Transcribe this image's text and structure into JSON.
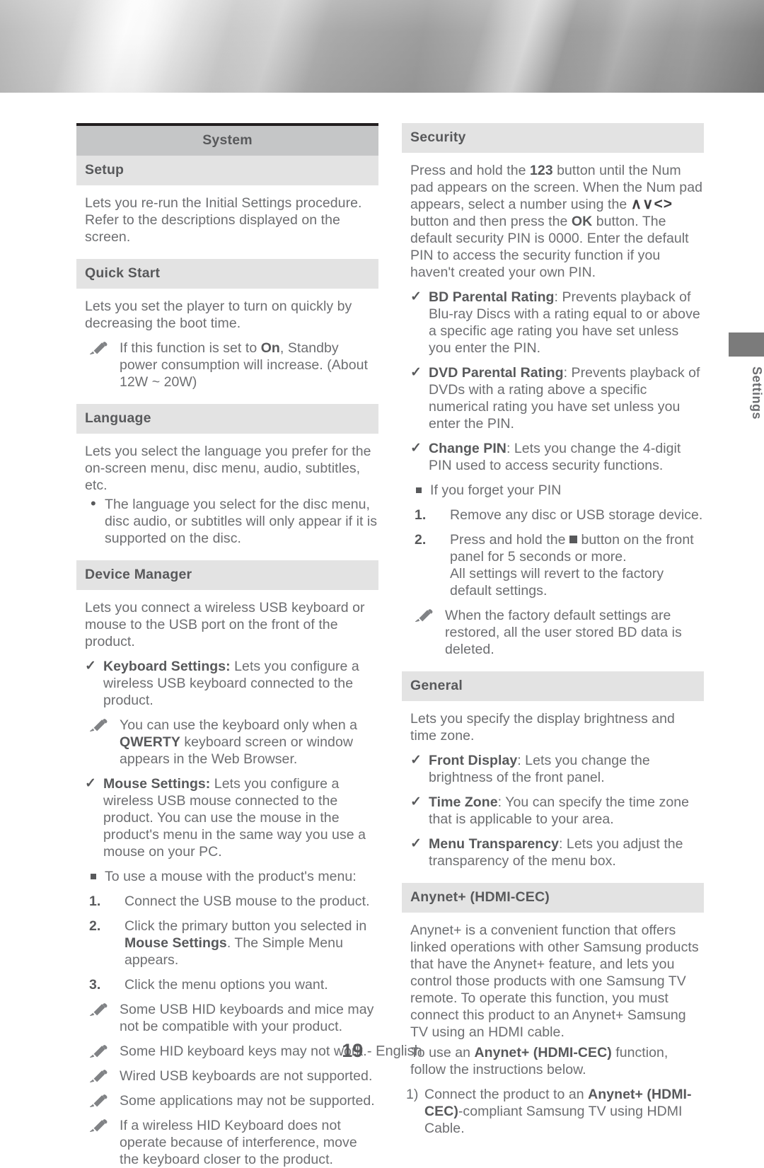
{
  "side_tab": {
    "label": "Settings"
  },
  "footer": {
    "page_number": "19",
    "separator": " - ",
    "language": "English"
  },
  "left_column": {
    "title": "System",
    "setup": {
      "heading": "Setup",
      "body": "Lets you re-run the Initial Settings procedure. Refer to the descriptions displayed on the screen."
    },
    "quick_start": {
      "heading": "Quick Start",
      "body": "Lets you set the player to turn on quickly by decreasing the boot time.",
      "note_prefix": "If this function is set to ",
      "note_bold": "On",
      "note_suffix": ", Standby power consumption will increase. (About 12W ~ 20W)"
    },
    "language": {
      "heading": "Language",
      "body": "Lets you select the language you prefer for the on-screen menu, disc menu, audio, subtitles, etc.",
      "bullet": "The language you select for the disc menu, disc audio, or subtitles will only appear if it is supported on the disc."
    },
    "device_manager": {
      "heading": "Device Manager",
      "body": "Lets you connect a wireless USB keyboard or mouse to the USB port on the front of the product.",
      "keyboard_settings_label": "Keyboard Settings:",
      "keyboard_settings_text": " Lets you configure a wireless USB keyboard connected to the product.",
      "keyboard_note_part1": "You can use the keyboard only when a ",
      "keyboard_note_bold": "QWERTY",
      "keyboard_note_part2": " keyboard screen or window appears in the Web Browser.",
      "mouse_settings_label": "Mouse Settings:",
      "mouse_settings_text": " Lets you configure a wireless USB mouse connected to the product. You can use the mouse in the product's menu in the same way you use a mouse on your PC.",
      "mouse_intro": "To use a mouse with the product's menu:",
      "steps": [
        {
          "num": "1.",
          "text": "Connect the USB mouse to the product."
        },
        {
          "num": "2.",
          "part1": "Click the primary button you selected in ",
          "bold": "Mouse Settings",
          "part2": ". The Simple Menu appears."
        },
        {
          "num": "3.",
          "text": "Click the menu options you want."
        }
      ],
      "notes": [
        "Some USB HID keyboards and mice may not be compatible with your product.",
        "Some HID keyboard keys may not work.",
        "Wired USB keyboards are not supported.",
        "Some applications may not be supported.",
        "If a wireless HID Keyboard does not operate because of interference, move the keyboard closer to the product."
      ]
    }
  },
  "right_column": {
    "security": {
      "heading": "Security",
      "body_p1": "Press and hold the ",
      "body_b1": "123",
      "body_p2": " button until the Num pad appears on the screen. When the Num pad appears, select a number using the ",
      "arrows_glyph": "∧∨<>",
      "body_p3": " button and then press the ",
      "body_b2": "OK",
      "body_p4": " button. The default security PIN is 0000. Enter the default PIN to access the security function if you haven't created your own PIN.",
      "items": [
        {
          "label": "BD Parental Rating",
          "text": ": Prevents playback of Blu-ray Discs with a rating equal to or above a specific age rating you have set unless you enter the PIN."
        },
        {
          "label": "DVD Parental Rating",
          "text": ": Prevents playback of DVDs with a rating above a specific numerical rating you have set unless you enter the PIN."
        },
        {
          "label": "Change PIN",
          "text": ": Lets you change the 4-digit PIN used to access security functions."
        }
      ],
      "forgot_pin_heading": "If you forget your PIN",
      "forgot_steps": [
        {
          "num": "1.",
          "text": "Remove any disc or USB storage device."
        },
        {
          "num": "2.",
          "part1": "Press and hold the ",
          "part2": " button on the front panel for 5 seconds or more.",
          "part3": "All settings will revert to the factory default settings."
        }
      ],
      "restore_note": "When the factory default settings are restored, all the user stored BD data is deleted."
    },
    "general": {
      "heading": "General",
      "body": "Lets you specify the display brightness and time zone.",
      "items": [
        {
          "label": "Front Display",
          "text": ": Lets you change the brightness of the front panel."
        },
        {
          "label": "Time Zone",
          "text": ": You can specify the time zone that is applicable to your area."
        },
        {
          "label": "Menu Transparency",
          "text": ": Lets you adjust the transparency of the menu box."
        }
      ]
    },
    "anynet": {
      "heading": "Anynet+ (HDMI-CEC)",
      "body": "Anynet+ is a convenient function that offers linked operations with other Samsung products that have the Anynet+ feature, and lets you control those products with one Samsung TV remote. To operate this function, you must connect this product to an Anynet+ Samsung TV using an HDMI cable.",
      "use_p1": "To use an ",
      "use_b1": "Anynet+ (HDMI-CEC)",
      "use_p2": " function, follow the instructions below.",
      "step1_num": "1)",
      "step1_p1": "Connect the product to an ",
      "step1_b1": "Anynet+ (HDMI-CEC)",
      "step1_p2": "-compliant Samsung TV using HDMI Cable."
    }
  }
}
